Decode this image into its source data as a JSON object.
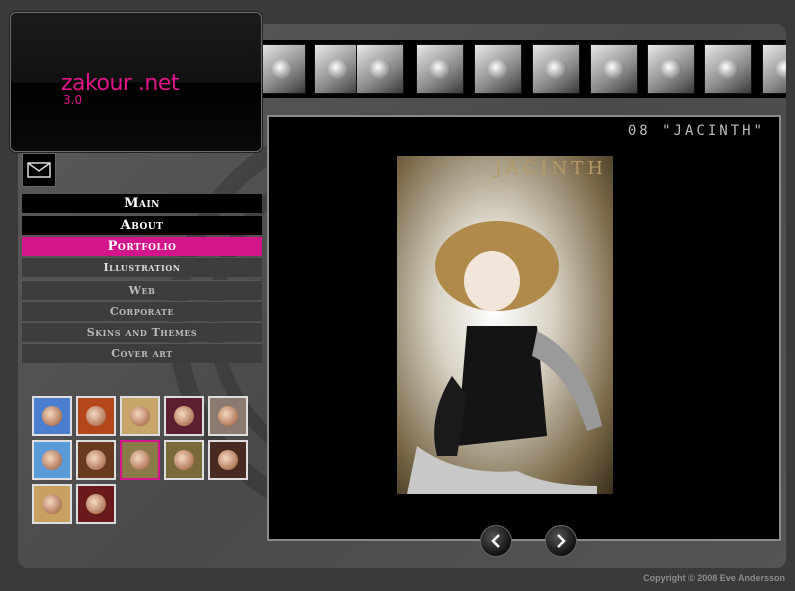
{
  "logo": {
    "name": "zakour .net",
    "version": "3.0"
  },
  "nav": {
    "main": "Main",
    "about": "About",
    "portfolio": "Portfolio",
    "sub": [
      "Illustration",
      "Web",
      "Corporate",
      "Skins and Themes",
      "Cover art"
    ]
  },
  "viewer": {
    "caption": "08 \"JACINTH\"",
    "art_title": "JACINTH"
  },
  "gallery": {
    "count": 12,
    "selected_index": 8
  },
  "footer": {
    "copyright": "Copyright © 2008 Eve Andersson"
  },
  "colors": {
    "accent": "#d4148a",
    "background": "#3a3a3a"
  },
  "icons": {
    "mail": "mail-icon",
    "prev": "chevron-left-icon",
    "next": "chevron-right-icon"
  }
}
